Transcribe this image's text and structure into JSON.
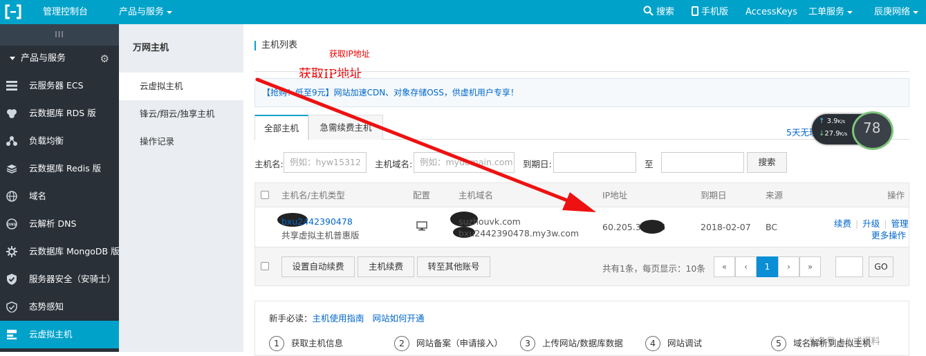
{
  "topbar": {
    "console": "管理控制台",
    "products": "产品与服务",
    "search": "搜索",
    "mobile": "手机版",
    "access_keys": "AccessKeys",
    "tickets": "工单服务",
    "user": "辰庚网络"
  },
  "sidebar": {
    "collapse": "III",
    "section": "产品与服务",
    "items": [
      {
        "label": "云服务器 ECS",
        "icon": "server-icon"
      },
      {
        "label": "云数据库 RDS 版",
        "icon": "database-icon"
      },
      {
        "label": "负载均衡",
        "icon": "load-balancer-icon"
      },
      {
        "label": "云数据库 Redis 版",
        "icon": "redis-icon"
      },
      {
        "label": "域名",
        "icon": "globe-icon"
      },
      {
        "label": "云解析 DNS",
        "icon": "dns-icon"
      },
      {
        "label": "云数据库 MongoDB 版",
        "icon": "mongodb-icon"
      },
      {
        "label": "服务器安全（安骑士）",
        "icon": "shield-icon"
      },
      {
        "label": "态势感知",
        "icon": "situation-icon"
      },
      {
        "label": "云虚拟主机",
        "icon": "virtual-host-icon"
      }
    ]
  },
  "subnav": {
    "title": "万网主机",
    "items": [
      "云虚拟主机",
      "锋云/翔云/独享主机",
      "操作记录"
    ]
  },
  "main": {
    "title": "主机列表",
    "annotation_small": "获取IP地址",
    "annotation_large": "获取IP地址",
    "promo_bracket": "【抢购！低至9元】",
    "promo_text": "网站加速CDN、对象存储OSS，供虚机用户专享！",
    "tabs": [
      "全部主机",
      "急需续费主机"
    ],
    "renew_link": "5天无理由退款  自动续费",
    "speed": {
      "up": "3.9",
      "down": "27.9",
      "unit": "K/s",
      "percent": "78"
    },
    "filters": {
      "host_name_label": "主机名:",
      "host_name_placeholder": "例如：hyw15312",
      "domain_label": "主机域名:",
      "domain_placeholder": "例如：mydomain.com",
      "expire_label": "到期日:",
      "to_label": "至",
      "search_button": "搜索"
    },
    "table": {
      "headers": [
        "主机名/主机类型",
        "配置",
        "主机域名",
        "IP地址",
        "到期日",
        "来源",
        "操作"
      ],
      "row": {
        "host_name": "bxu2442390478",
        "host_type": "共享虚拟主机普惠版",
        "domain1": "suzhouvk.com",
        "domain2": "bxu2442390478.my3w.com",
        "ip": "60.205.35.105",
        "expire": "2018-02-07",
        "source": "BC",
        "renew": "续费",
        "upgrade": "升级",
        "manage": "管理",
        "more": "更多操作"
      }
    },
    "footer": {
      "auto_renew": "设置自动续费",
      "renew": "主机续费",
      "transfer": "转至其他账号",
      "summary": "共有1条，每页显示：10条",
      "pages": [
        "«",
        "‹",
        "1",
        "›",
        "»"
      ],
      "go": "GO"
    },
    "guide": {
      "label": "新手必读：",
      "link1": "主机使用指南",
      "link2": "网站如何开通",
      "steps": [
        {
          "num": "1",
          "label": "获取主机信息"
        },
        {
          "num": "2",
          "label": "网站备案（申请接入）"
        },
        {
          "num": "3",
          "label": "上传网站/数据库数据"
        },
        {
          "num": "4",
          "label": "网站调试"
        },
        {
          "num": "5",
          "label": "域名解析到虚拟主机"
        }
      ],
      "watermark": "头条号 / 八戒爆料"
    }
  }
}
